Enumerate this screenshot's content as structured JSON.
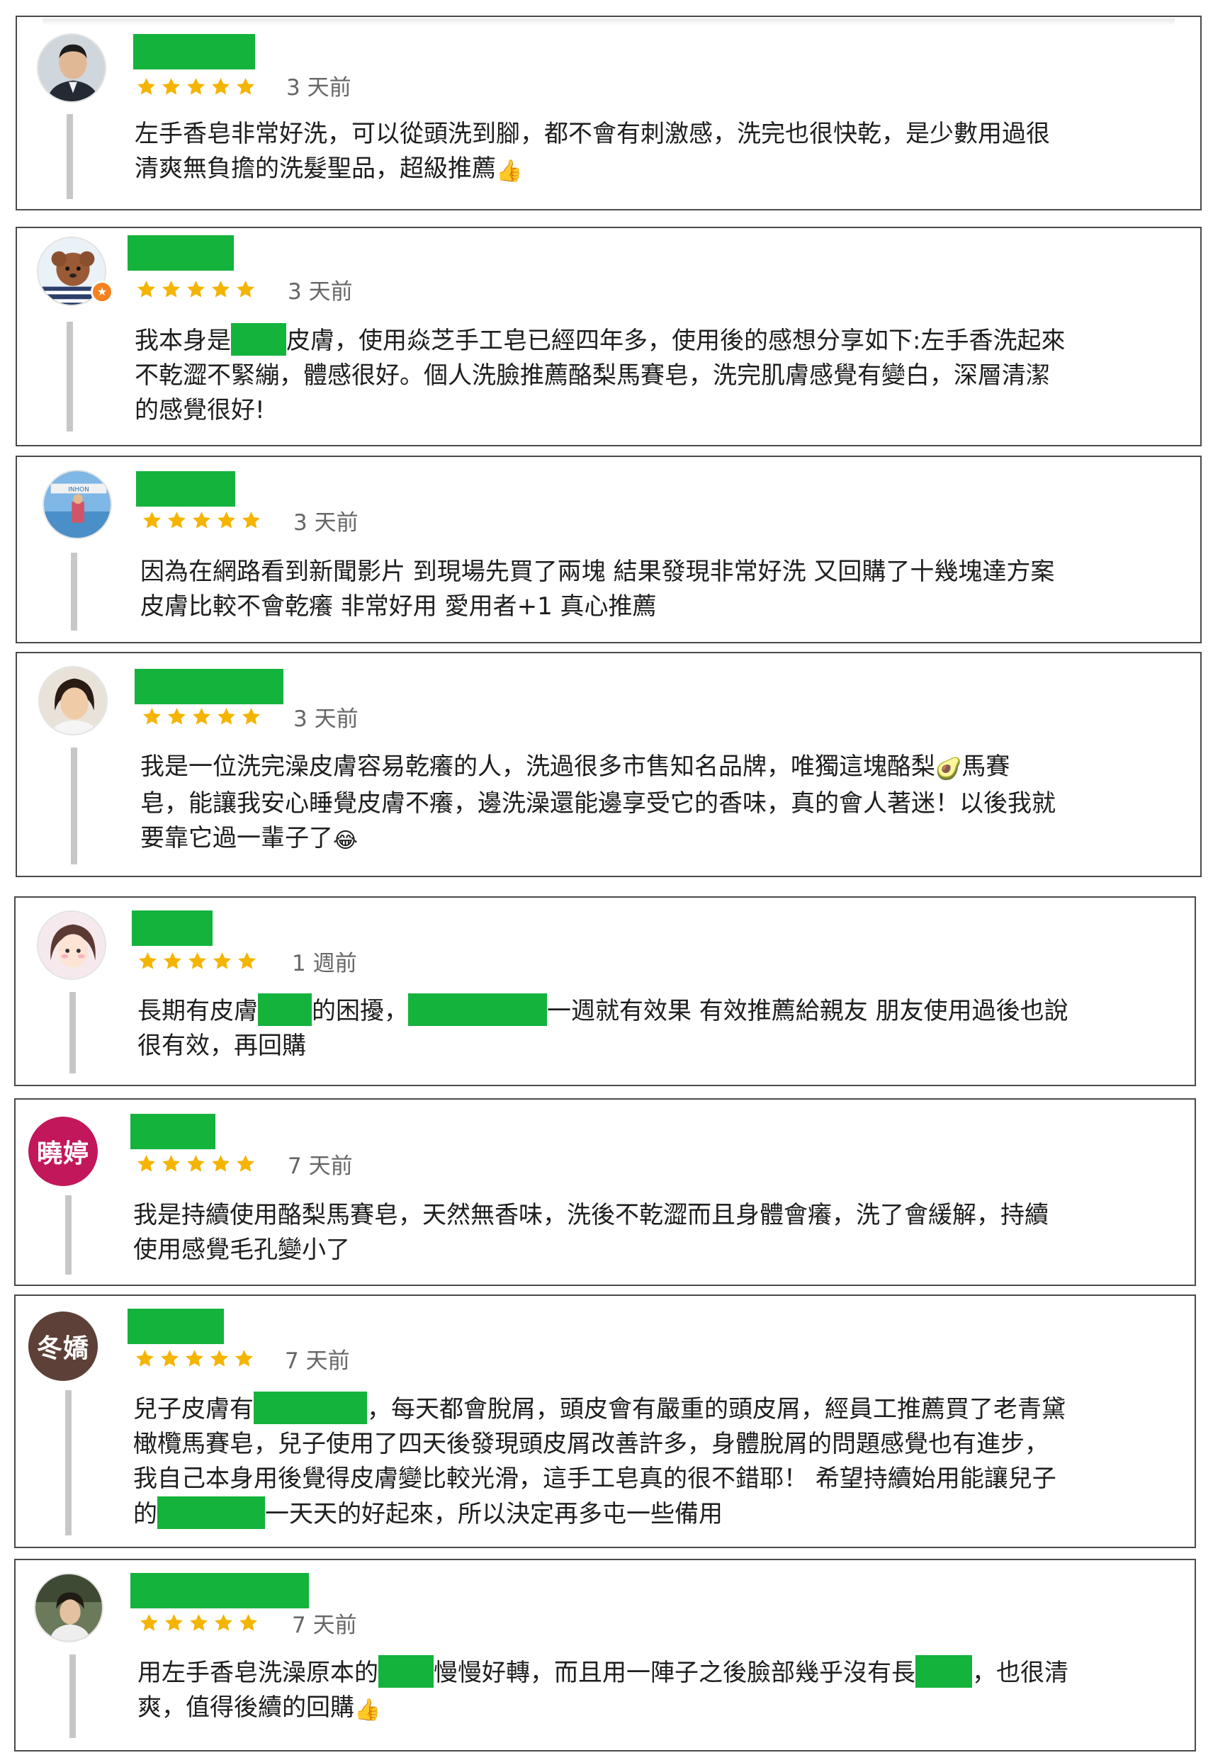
{
  "colors": {
    "star": "#f4b400",
    "redaction": "#14b33c",
    "border": "#4a4a4a",
    "quote_bar": "#c7c7c7"
  },
  "reviews": [
    {
      "avatar": "profile-photo-man",
      "rating": 5,
      "time": "3 天前",
      "line1": "左手香皂非常好洗，可以從頭洗到腳，都不會有刺激感，洗完也很快乾，是少數用過很",
      "line2": "清爽無負擔的洗髮聖品，超級推薦",
      "emoji": "👍"
    },
    {
      "avatar": "profile-photo-dog",
      "rating": 5,
      "time": "3 天前",
      "line1a": "我本身是",
      "line1b": "皮膚，使用焱芝手工皂已經四年多，使用後的感想分享如下:左手香洗起來",
      "line2": "不乾澀不緊繃，體感很好。個人洗臉推薦酪梨馬賽皂，洗完肌膚感覺有變白，深層清潔",
      "line3": "的感覺很好!"
    },
    {
      "avatar": "profile-photo-gym",
      "rating": 5,
      "time": "3 天前",
      "line1": "因為在網路看到新聞影片 到現場先買了兩塊 結果發現非常好洗 又回購了十幾塊達方案",
      "line2": "皮膚比較不會乾癢 非常好用 愛用者+1 真心推薦"
    },
    {
      "avatar": "profile-photo-woman",
      "rating": 5,
      "time": "3 天前",
      "line1a": "我是一位洗完澡皮膚容易乾癢的人，洗過很多市售知名品牌，唯獨這塊酪梨",
      "emoji1": "🥑",
      "line1b": "馬賽",
      "line2": "皂，能讓我安心睡覺皮膚不癢，邊洗澡還能邊享受它的香味，真的會人著迷！以後我就",
      "line3": "要靠它過一輩子了",
      "emoji2": "😂"
    },
    {
      "avatar": "profile-cartoon-girl",
      "rating": 5,
      "time": "1 週前",
      "line1a": "長期有皮膚",
      "line1b": "的困擾，",
      "line1c": "一週就有效果 有效推薦給親友 朋友使用過後也說",
      "line2": "很有效，再回購"
    },
    {
      "avatar_text": "曉婷",
      "avatar_color": "#c2185b",
      "rating": 5,
      "time": "7 天前",
      "line1": "我是持續使用酪梨馬賽皂，天然無香味，洗後不乾澀而且身體會癢，洗了會緩解，持續",
      "line2": "使用感覺毛孔變小了"
    },
    {
      "avatar_text": "冬嬌",
      "avatar_color": "#5d4037",
      "rating": 5,
      "time": "7 天前",
      "line1a": "兒子皮膚有",
      "line1b": "，每天都會脫屑，頭皮會有嚴重的頭皮屑，經員工推薦買了老青黛",
      "line2": "橄欖馬賽皂，兒子使用了四天後發現頭皮屑改善許多，身體脫屑的問題感覺也有進步，",
      "line3": "我自己本身用後覺得皮膚變比較光滑，這手工皂真的很不錯耶！ 希望持續始用能讓兒子",
      "line4a": "的",
      "line4b": "一天天的好起來，所以決定再多屯一些備用"
    },
    {
      "avatar": "profile-photo-child",
      "rating": 5,
      "time": "7 天前",
      "line1a": "用左手香皂洗澡原本的",
      "line1b": "慢慢好轉，而且用一陣子之後臉部幾乎沒有長",
      "line1c": "，也很清",
      "line2": "爽，值得後續的回購",
      "emoji": "👍"
    }
  ]
}
